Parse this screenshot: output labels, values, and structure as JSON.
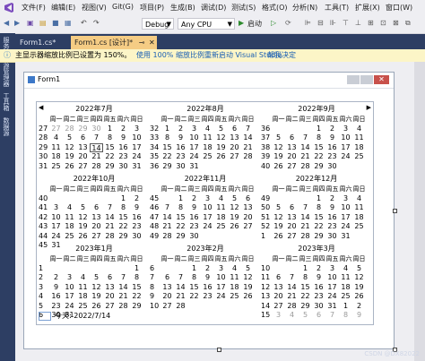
{
  "menu": [
    "文件(F)",
    "编辑(E)",
    "视图(V)",
    "Git(G)",
    "项目(P)",
    "生成(B)",
    "调试(D)",
    "测试(S)",
    "格式(O)",
    "分析(N)",
    "工具(T)",
    "扩展(X)",
    "窗口(W)"
  ],
  "toolbar": {
    "config": "Debug",
    "platform": "Any CPU",
    "start": "启动"
  },
  "tabs": [
    {
      "label": "Form1.cs*"
    },
    {
      "label": "Form1.cs [设计]*",
      "active": true
    }
  ],
  "side": {
    "toolbox": "服务器资源管理器",
    "toolbox2": "工具箱",
    "datasrc": "数据源"
  },
  "info": {
    "message": "主显示器缩放比例已设置为 150%。",
    "link1": "使用 100% 缩放比例重新启动 Visual Studio",
    "link2": "帮我决定"
  },
  "form": {
    "title": "Form1"
  },
  "calendar": {
    "weekdays": [
      "周一",
      "周二",
      "周三",
      "周四",
      "周五",
      "周六",
      "周日"
    ],
    "today_label": "今天: 2022/7/14",
    "months": [
      {
        "title": "2022年7月",
        "weeks": [
          [
            "27",
            "27",
            "28",
            "29",
            "30",
            "1",
            "2",
            "3"
          ],
          [
            "28",
            "4",
            "5",
            "6",
            "7",
            "8",
            "9",
            "10"
          ],
          [
            "29",
            "11",
            "12",
            "13",
            "14",
            "15",
            "16",
            "17"
          ],
          [
            "30",
            "18",
            "19",
            "20",
            "21",
            "22",
            "23",
            "24"
          ],
          [
            "31",
            "25",
            "26",
            "27",
            "28",
            "29",
            "30",
            "31"
          ]
        ],
        "today": [
          2,
          4
        ]
      },
      {
        "title": "2022年8月",
        "weeks": [
          [
            "32",
            "1",
            "2",
            "3",
            "4",
            "5",
            "6",
            "7"
          ],
          [
            "33",
            "8",
            "9",
            "10",
            "11",
            "12",
            "13",
            "14"
          ],
          [
            "34",
            "15",
            "16",
            "17",
            "18",
            "19",
            "20",
            "21"
          ],
          [
            "35",
            "22",
            "23",
            "24",
            "25",
            "26",
            "27",
            "28"
          ],
          [
            "36",
            "29",
            "30",
            "31",
            "",
            "",
            "",
            ""
          ]
        ]
      },
      {
        "title": "2022年9月",
        "weeks": [
          [
            "36",
            "",
            "",
            "",
            "1",
            "2",
            "3",
            "4"
          ],
          [
            "37",
            "5",
            "6",
            "7",
            "8",
            "9",
            "10",
            "11"
          ],
          [
            "38",
            "12",
            "13",
            "14",
            "15",
            "16",
            "17",
            "18"
          ],
          [
            "39",
            "19",
            "20",
            "21",
            "22",
            "23",
            "24",
            "25"
          ],
          [
            "40",
            "26",
            "27",
            "28",
            "29",
            "30",
            "",
            ""
          ]
        ]
      },
      {
        "title": "2022年10月",
        "weeks": [
          [
            "40",
            "",
            "",
            "",
            "",
            "",
            "1",
            "2"
          ],
          [
            "41",
            "3",
            "4",
            "5",
            "6",
            "7",
            "8",
            "9"
          ],
          [
            "42",
            "10",
            "11",
            "12",
            "13",
            "14",
            "15",
            "16"
          ],
          [
            "43",
            "17",
            "18",
            "19",
            "20",
            "21",
            "22",
            "23"
          ],
          [
            "44",
            "24",
            "25",
            "26",
            "27",
            "28",
            "29",
            "30"
          ],
          [
            "45",
            "31",
            "",
            "",
            "",
            "",
            "",
            ""
          ]
        ]
      },
      {
        "title": "2022年11月",
        "weeks": [
          [
            "45",
            "",
            "1",
            "2",
            "3",
            "4",
            "5",
            "6"
          ],
          [
            "46",
            "7",
            "8",
            "9",
            "10",
            "11",
            "12",
            "13"
          ],
          [
            "47",
            "14",
            "15",
            "16",
            "17",
            "18",
            "19",
            "20"
          ],
          [
            "48",
            "21",
            "22",
            "23",
            "24",
            "25",
            "26",
            "27"
          ],
          [
            "49",
            "28",
            "29",
            "30",
            "",
            "",
            "",
            ""
          ]
        ]
      },
      {
        "title": "2022年12月",
        "weeks": [
          [
            "49",
            "",
            "",
            "",
            "1",
            "2",
            "3",
            "4"
          ],
          [
            "50",
            "5",
            "6",
            "7",
            "8",
            "9",
            "10",
            "11"
          ],
          [
            "51",
            "12",
            "13",
            "14",
            "15",
            "16",
            "17",
            "18"
          ],
          [
            "52",
            "19",
            "20",
            "21",
            "22",
            "23",
            "24",
            "25"
          ],
          [
            "1",
            "26",
            "27",
            "28",
            "29",
            "30",
            "31",
            ""
          ]
        ]
      },
      {
        "title": "2023年1月",
        "weeks": [
          [
            "1",
            "",
            "",
            "",
            "",
            "",
            "",
            "1"
          ],
          [
            "2",
            "2",
            "3",
            "4",
            "5",
            "6",
            "7",
            "8"
          ],
          [
            "3",
            "9",
            "10",
            "11",
            "12",
            "13",
            "14",
            "15"
          ],
          [
            "4",
            "16",
            "17",
            "18",
            "19",
            "20",
            "21",
            "22"
          ],
          [
            "5",
            "23",
            "24",
            "25",
            "26",
            "27",
            "28",
            "29"
          ],
          [
            "6",
            "30",
            "31",
            "",
            "",
            "",
            "",
            ""
          ]
        ]
      },
      {
        "title": "2023年2月",
        "weeks": [
          [
            "6",
            "",
            "",
            "1",
            "2",
            "3",
            "4",
            "5"
          ],
          [
            "7",
            "6",
            "7",
            "8",
            "9",
            "10",
            "11",
            "12"
          ],
          [
            "8",
            "13",
            "14",
            "15",
            "16",
            "17",
            "18",
            "19"
          ],
          [
            "9",
            "20",
            "21",
            "22",
            "23",
            "24",
            "25",
            "26"
          ],
          [
            "10",
            "27",
            "28",
            "",
            "",
            "",
            "",
            ""
          ]
        ]
      },
      {
        "title": "2023年3月",
        "weeks": [
          [
            "10",
            "",
            "",
            "1",
            "2",
            "3",
            "4",
            "5"
          ],
          [
            "11",
            "6",
            "7",
            "8",
            "9",
            "10",
            "11",
            "12"
          ],
          [
            "12",
            "13",
            "14",
            "15",
            "16",
            "17",
            "18",
            "19"
          ],
          [
            "13",
            "20",
            "21",
            "22",
            "23",
            "24",
            "25",
            "26"
          ],
          [
            "14",
            "27",
            "28",
            "29",
            "30",
            "31",
            "1",
            "2"
          ],
          [
            "15",
            "3",
            "4",
            "5",
            "6",
            "7",
            "8",
            "9"
          ]
        ]
      }
    ]
  },
  "watermark": "CSDN @DX82022"
}
